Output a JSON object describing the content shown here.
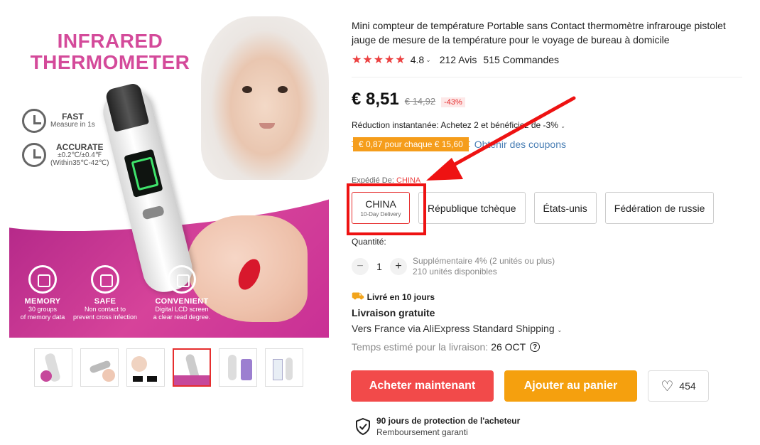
{
  "gallery": {
    "headline_line1": "INFRARED",
    "headline_line2": "THERMOMETER",
    "features_top": [
      {
        "title": "FAST",
        "desc": "Measure in 1s",
        "icon": "clock-icon"
      },
      {
        "title": "ACCURATE",
        "desc1": "±0.2℃/±0.4℉",
        "desc2": "(Within35℃-42℃)",
        "icon": "target-icon"
      }
    ],
    "features_bottom": [
      {
        "title": "MEMORY",
        "desc1": "30 groups",
        "desc2": "of memory data",
        "icon": "edit-icon"
      },
      {
        "title": "SAFE",
        "desc1": "Non contact to",
        "desc2": "prevent cross infection",
        "icon": "shield-check-icon"
      },
      {
        "title": "CONVENIENT",
        "desc1": "Digital LCD screen",
        "desc2": "a clear read degree.",
        "icon": "screen-icon"
      }
    ],
    "thumbnail_count": 6,
    "active_thumbnail": 4
  },
  "product": {
    "title": "Mini compteur de température Portable sans Contact thermomètre infrarouge pistolet jauge de mesure de la température pour le voyage de bureau à domicile",
    "stars": "★★★★★",
    "rating": "4.8",
    "reviews": "212 Avis",
    "orders": "515 Commandes"
  },
  "pricing": {
    "price": "€ 8,51",
    "old_price": "€ 14,92",
    "discount": "-43%",
    "instant_reduction": "Réduction instantanée: Achetez 2 et bénéficiez de -3%",
    "coupon": "€ 0,87 pour chaque € 15,60",
    "coupon_link": "Obtenir des coupons"
  },
  "shipping_from": {
    "label": "Expédié De:",
    "value": "CHINA",
    "options": [
      {
        "label": "CHINA",
        "sub": "10-Day Delivery",
        "selected": true
      },
      {
        "label": "République tchèque"
      },
      {
        "label": "États-unis"
      },
      {
        "label": "Fédération de russie"
      }
    ]
  },
  "quantity": {
    "label": "Quantité:",
    "minus": "−",
    "plus": "+",
    "value": "1",
    "bulk_note": "Supplémentaire 4% (2 unités ou plus)",
    "available": "210 unités disponibles"
  },
  "delivery": {
    "badge": "Livré en 10 jours",
    "free": "Livraison gratuite",
    "via": "Vers France via AliExpress Standard Shipping",
    "est_label": "Temps estimé pour la livraison:",
    "est_date": "26 OCT",
    "help": "?"
  },
  "actions": {
    "buy_now": "Acheter maintenant",
    "add_to_cart": "Ajouter au panier",
    "wishlist_count": "454"
  },
  "protection": {
    "title": "90 jours de protection de l'acheteur",
    "subtitle": "Remboursement garanti"
  },
  "annotation": {
    "box_color": "#ee1212",
    "arrow_color": "#ee1212"
  }
}
